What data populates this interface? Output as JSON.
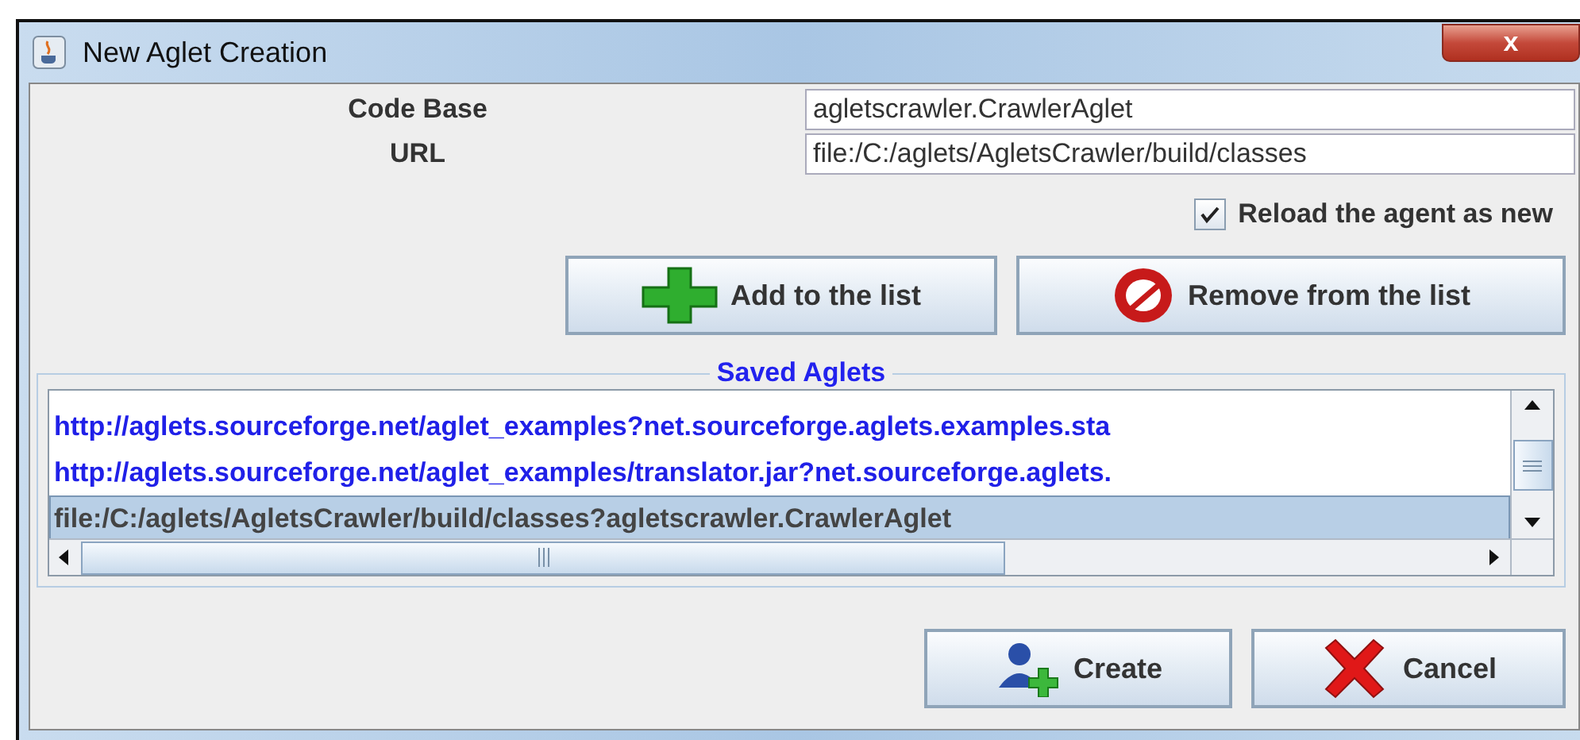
{
  "window": {
    "title": "New Aglet Creation",
    "close_label": "x"
  },
  "form": {
    "fields": [
      {
        "label": "Code Base",
        "value": "agletscrawler.CrawlerAglet"
      },
      {
        "label": "URL",
        "value": "file:/C:/aglets/AgletsCrawler/build/classes"
      }
    ],
    "reload_checkbox": {
      "label": "Reload the agent as new",
      "checked": true
    },
    "list_buttons": [
      {
        "kind": "add",
        "label": "Add to the list"
      },
      {
        "kind": "remove",
        "label": "Remove from the list"
      }
    ]
  },
  "saved_aglets": {
    "title": "Saved Aglets",
    "items": [
      {
        "text": "http://aglets.sourceforge.net/aglet_examples?net.sourceforge.aglets.examples.sta",
        "selected": false
      },
      {
        "text": "http://aglets.sourceforge.net/aglet_examples/translator.jar?net.sourceforge.aglets.",
        "selected": false
      },
      {
        "text": "file:/C:/aglets/AgletsCrawler/build/classes?agletscrawler.CrawlerAglet",
        "selected": true
      }
    ]
  },
  "buttons": [
    {
      "kind": "create",
      "label": "Create"
    },
    {
      "kind": "cancel",
      "label": "Cancel"
    }
  ]
}
